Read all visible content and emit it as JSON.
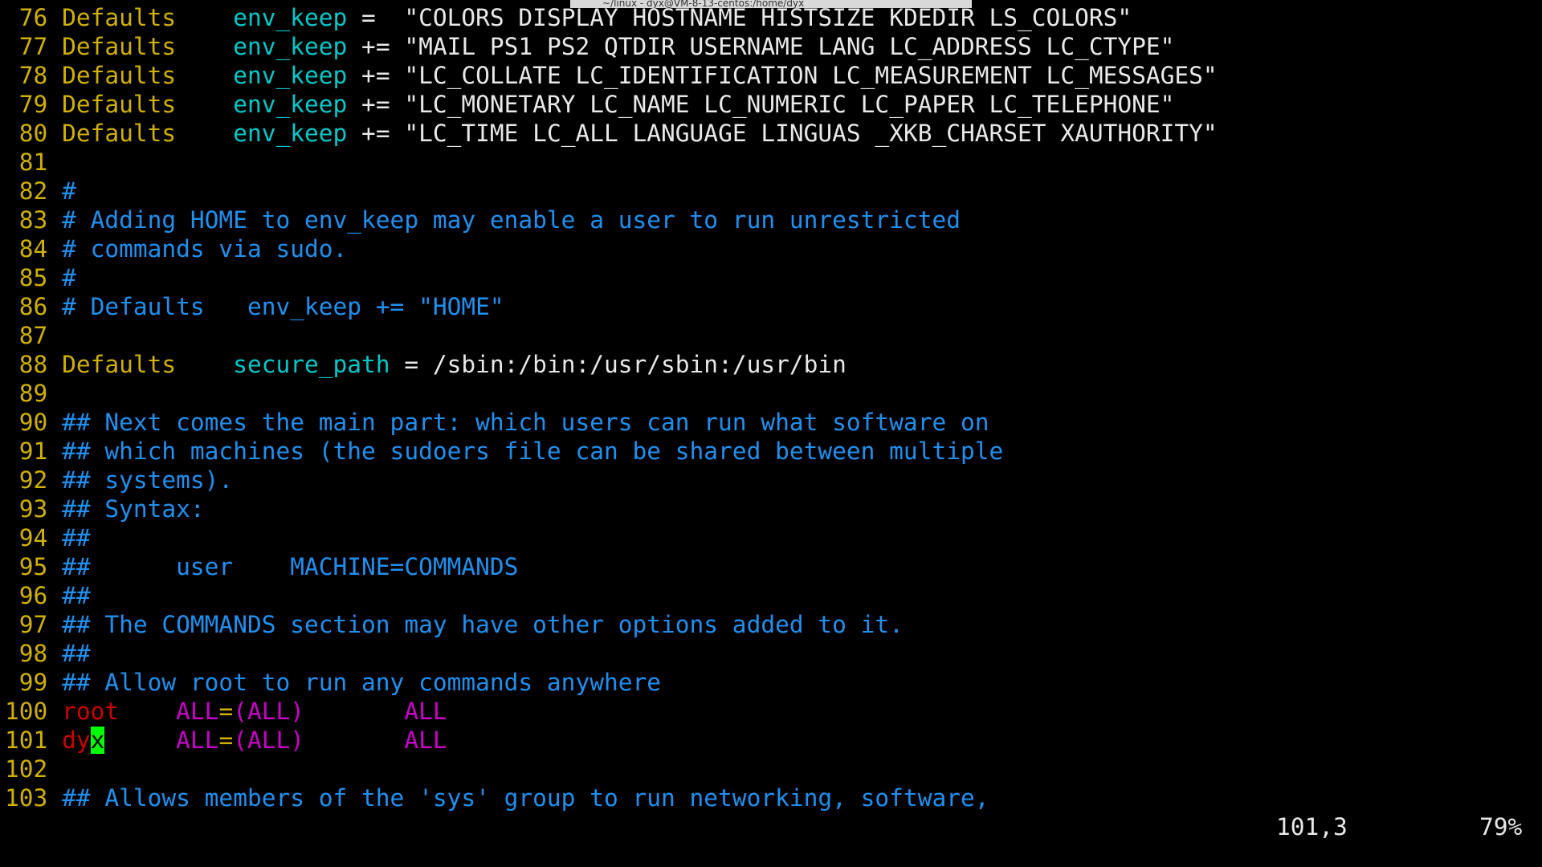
{
  "window": {
    "title": "~/linux - dyx@VM-8-13-centos:/home/dyx"
  },
  "colors": {
    "yellow": "#d0b000",
    "cyan": "#00c8c8",
    "white": "#e8e8e8",
    "blue": "#2090f0",
    "red": "#cc0000",
    "magenta": "#c800c8",
    "cursor": "#00ff00"
  },
  "lines": [
    {
      "n": " 76",
      "segs": [
        [
          "Defaults",
          "yellow"
        ],
        [
          "    ",
          "white"
        ],
        [
          "env_keep",
          "cyan"
        ],
        [
          " =  \"COLORS DISPLAY HOSTNAME HISTSIZE KDEDIR LS_COLORS\"",
          "white"
        ]
      ]
    },
    {
      "n": " 77",
      "segs": [
        [
          "Defaults",
          "yellow"
        ],
        [
          "    ",
          "white"
        ],
        [
          "env_keep",
          "cyan"
        ],
        [
          " += \"MAIL PS1 PS2 QTDIR USERNAME LANG LC_ADDRESS LC_CTYPE\"",
          "white"
        ]
      ]
    },
    {
      "n": " 78",
      "segs": [
        [
          "Defaults",
          "yellow"
        ],
        [
          "    ",
          "white"
        ],
        [
          "env_keep",
          "cyan"
        ],
        [
          " += \"LC_COLLATE LC_IDENTIFICATION LC_MEASUREMENT LC_MESSAGES\"",
          "white"
        ]
      ]
    },
    {
      "n": " 79",
      "segs": [
        [
          "Defaults",
          "yellow"
        ],
        [
          "    ",
          "white"
        ],
        [
          "env_keep",
          "cyan"
        ],
        [
          " += \"LC_MONETARY LC_NAME LC_NUMERIC LC_PAPER LC_TELEPHONE\"",
          "white"
        ]
      ]
    },
    {
      "n": " 80",
      "segs": [
        [
          "Defaults",
          "yellow"
        ],
        [
          "    ",
          "white"
        ],
        [
          "env_keep",
          "cyan"
        ],
        [
          " += \"LC_TIME LC_ALL LANGUAGE LINGUAS _XKB_CHARSET XAUTHORITY\"",
          "white"
        ]
      ]
    },
    {
      "n": " 81",
      "segs": []
    },
    {
      "n": " 82",
      "segs": [
        [
          "#",
          "blue"
        ]
      ]
    },
    {
      "n": " 83",
      "segs": [
        [
          "# Adding HOME to env_keep may enable a user to run unrestricted",
          "blue"
        ]
      ]
    },
    {
      "n": " 84",
      "segs": [
        [
          "# commands via sudo.",
          "blue"
        ]
      ]
    },
    {
      "n": " 85",
      "segs": [
        [
          "#",
          "blue"
        ]
      ]
    },
    {
      "n": " 86",
      "segs": [
        [
          "# Defaults   env_keep += \"HOME\"",
          "blue"
        ]
      ]
    },
    {
      "n": " 87",
      "segs": []
    },
    {
      "n": " 88",
      "segs": [
        [
          "Defaults",
          "yellow"
        ],
        [
          "    ",
          "white"
        ],
        [
          "secure_path",
          "cyan"
        ],
        [
          " = /sbin:/bin:/usr/sbin:/usr/bin",
          "white"
        ]
      ]
    },
    {
      "n": " 89",
      "segs": []
    },
    {
      "n": " 90",
      "segs": [
        [
          "## Next comes the main part: which users can run what software on",
          "blue"
        ]
      ]
    },
    {
      "n": " 91",
      "segs": [
        [
          "## which machines (the sudoers file can be shared between multiple",
          "blue"
        ]
      ]
    },
    {
      "n": " 92",
      "segs": [
        [
          "## systems).",
          "blue"
        ]
      ]
    },
    {
      "n": " 93",
      "segs": [
        [
          "## Syntax:",
          "blue"
        ]
      ]
    },
    {
      "n": " 94",
      "segs": [
        [
          "##",
          "blue"
        ]
      ]
    },
    {
      "n": " 95",
      "segs": [
        [
          "##      user    MACHINE=COMMANDS",
          "blue"
        ]
      ]
    },
    {
      "n": " 96",
      "segs": [
        [
          "##",
          "blue"
        ]
      ]
    },
    {
      "n": " 97",
      "segs": [
        [
          "## The COMMANDS section may have other options added to it.",
          "blue"
        ]
      ]
    },
    {
      "n": " 98",
      "segs": [
        [
          "##",
          "blue"
        ]
      ]
    },
    {
      "n": " 99",
      "segs": [
        [
          "## Allow root to run any commands anywhere",
          "blue"
        ]
      ]
    },
    {
      "n": "100",
      "segs": [
        [
          "root",
          "red"
        ],
        [
          "    ",
          "white"
        ],
        [
          "ALL",
          "magenta"
        ],
        [
          "=",
          "yellow"
        ],
        [
          "(ALL)",
          "magenta"
        ],
        [
          "       ",
          "white"
        ],
        [
          "ALL",
          "magenta"
        ]
      ]
    },
    {
      "n": "101",
      "segs": [
        [
          "dy",
          "red"
        ],
        [
          "x",
          "cursor"
        ],
        [
          "     ",
          "white"
        ],
        [
          "ALL",
          "magenta"
        ],
        [
          "=",
          "yellow"
        ],
        [
          "(ALL)",
          "magenta"
        ],
        [
          "       ",
          "white"
        ],
        [
          "ALL",
          "magenta"
        ]
      ]
    },
    {
      "n": "102",
      "segs": []
    },
    {
      "n": "103",
      "segs": [
        [
          "## Allows members of the 'sys' group to run networking, software,",
          "blue"
        ]
      ]
    }
  ],
  "status": {
    "ruler": "101,3",
    "percent": "79%"
  }
}
